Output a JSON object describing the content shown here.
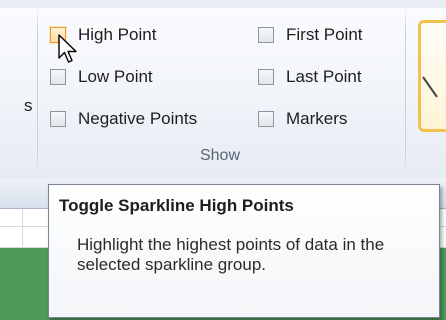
{
  "ribbon": {
    "clipped_left_text": "s",
    "show_group": {
      "label": "Show",
      "options": [
        {
          "label": "High Point",
          "checked": false,
          "hovered": true
        },
        {
          "label": "Low Point",
          "checked": false,
          "hovered": false
        },
        {
          "label": "Negative Points",
          "checked": false,
          "hovered": false
        },
        {
          "label": "First Point",
          "checked": false,
          "hovered": false
        },
        {
          "label": "Last Point",
          "checked": false,
          "hovered": false
        },
        {
          "label": "Markers",
          "checked": false,
          "hovered": false
        }
      ]
    }
  },
  "tooltip": {
    "title": "Toggle Sparkline High Points",
    "body": "Highlight the highest points of data in the selected sparkline group."
  },
  "colors": {
    "hover_highlight": "#ffd99a",
    "sheet_fill": "#4f9a5a",
    "gallery_border": "#f2c14e"
  },
  "icons": [
    "mouse-pointer-icon",
    "chevron-down-icon"
  ]
}
